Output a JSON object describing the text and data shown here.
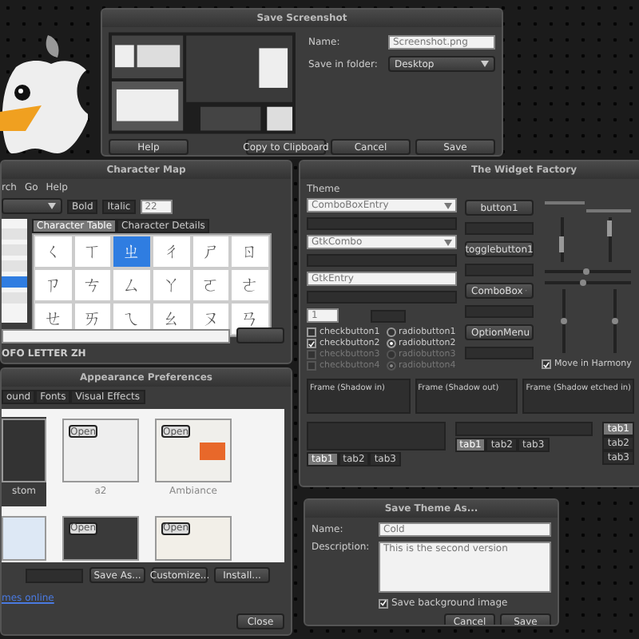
{
  "save_screenshot": {
    "title": "Save Screenshot",
    "name_label": "Name:",
    "name_value": "Screenshot.png",
    "folder_label": "Save in folder:",
    "folder_value": "Desktop",
    "buttons": [
      "Help",
      "Copy to Clipboard",
      "Cancel",
      "Save"
    ]
  },
  "character_map": {
    "title": "Character Map",
    "menu": [
      "rch",
      "Go",
      "Help"
    ],
    "style_buttons": [
      {
        "label": "Bold",
        "selected": false
      },
      {
        "label": "Italic",
        "selected": false
      }
    ],
    "font_size": "22",
    "font_list": [
      {
        "selected": false
      },
      {
        "selected": false
      },
      {
        "selected": false
      },
      {
        "selected": true
      },
      {
        "selected": false
      }
    ],
    "tabs": [
      {
        "label": "Character Table",
        "selected": true
      },
      {
        "label": "Character Details",
        "selected": false
      }
    ],
    "characters": [
      {
        "char": "ㄑ",
        "selected": false
      },
      {
        "char": "ㄒ",
        "selected": false
      },
      {
        "char": "ㄓ",
        "selected": true
      },
      {
        "char": "ㄔ",
        "selected": false
      },
      {
        "char": "ㄕ",
        "selected": false
      },
      {
        "char": "ㄖ",
        "selected": false
      },
      {
        "char": "ㄗ",
        "selected": false
      },
      {
        "char": "ㄘ",
        "selected": false
      },
      {
        "char": "ㄙ",
        "selected": false
      },
      {
        "char": "ㄚ",
        "selected": false
      },
      {
        "char": "ㄛ",
        "selected": false
      },
      {
        "char": "ㄜ",
        "selected": false
      },
      {
        "char": "ㄝ",
        "selected": false
      },
      {
        "char": "ㄞ",
        "selected": false
      },
      {
        "char": "ㄟ",
        "selected": false
      },
      {
        "char": "ㄠ",
        "selected": false
      },
      {
        "char": "ㄡ",
        "selected": false
      },
      {
        "char": "ㄢ",
        "selected": false
      }
    ],
    "status": "OFO LETTER ZH"
  },
  "widget_factory": {
    "title": "The Widget Factory",
    "menu": "Theme",
    "combos": [
      {
        "kind": "combo",
        "value": "ComboBoxEntry"
      },
      {
        "kind": "combo",
        "value": "GtkCombo"
      },
      {
        "kind": "entry",
        "value": "GtkEntry"
      }
    ],
    "spin_value": "1",
    "checks": [
      {
        "label": "checkbutton1",
        "checked": false,
        "disabled": false
      },
      {
        "label": "checkbutton2",
        "checked": true,
        "disabled": false
      },
      {
        "label": "checkbutton3",
        "checked": false,
        "disabled": true
      },
      {
        "label": "checkbutton4",
        "checked": false,
        "disabled": true
      }
    ],
    "radios": [
      {
        "label": "radiobutton1",
        "selected": false,
        "disabled": false
      },
      {
        "label": "radiobutton2",
        "selected": true,
        "disabled": false
      },
      {
        "label": "radiobutton3",
        "selected": false,
        "disabled": true
      },
      {
        "label": "radiobutton4",
        "selected": true,
        "disabled": true
      }
    ],
    "buttons": [
      {
        "kind": "button",
        "label": "button1"
      },
      {
        "kind": "button",
        "label": "togglebutton1"
      },
      {
        "kind": "dropdown",
        "label": "ComboBox"
      },
      {
        "kind": "dropdown",
        "label": "OptionMenu"
      }
    ],
    "harmony": {
      "label": "Move in Harmony",
      "checked": true
    },
    "frames": [
      "Frame (Shadow in)",
      "Frame (Shadow out)",
      "Frame (Shadow etched in)"
    ],
    "tab_sets": [
      [
        {
          "label": "tab1",
          "selected": true
        },
        {
          "label": "tab2",
          "selected": false
        },
        {
          "label": "tab3",
          "selected": false
        }
      ],
      [
        {
          "label": "tab1",
          "selected": true
        },
        {
          "label": "tab2",
          "selected": false
        },
        {
          "label": "tab3",
          "selected": false
        }
      ],
      [
        {
          "label": "tab1",
          "selected": true
        },
        {
          "label": "tab2",
          "selected": false
        },
        {
          "label": "tab3",
          "selected": false
        }
      ]
    ]
  },
  "appearance": {
    "title": "Appearance Preferences",
    "tabs": [
      {
        "label": "ound",
        "selected": false
      },
      {
        "label": "Fonts",
        "selected": false
      },
      {
        "label": "Visual Effects",
        "selected": false
      }
    ],
    "themes": [
      {
        "kind": "dark",
        "name": "stom",
        "selected": true
      },
      {
        "kind": "light",
        "name": "a2",
        "preview_label": "Open",
        "selected": false
      },
      {
        "kind": "ambiance",
        "name": "Ambiance",
        "preview_label": "Open",
        "selected": false
      },
      {
        "kind": "blue",
        "selected": false
      },
      {
        "kind": "darkred",
        "preview_label": "Open",
        "selected": false
      },
      {
        "kind": "beige",
        "preview_label": "Open",
        "selected": false
      }
    ],
    "buttons": [
      "Save As...",
      "Customize...",
      "Install..."
    ],
    "link": "mes online",
    "close": "Close"
  },
  "save_theme": {
    "title": "Save Theme As...",
    "name_label": "Name:",
    "name_value": "Cold",
    "description_label": "Description:",
    "description_value": "This is the second version",
    "background": {
      "label": "Save background image",
      "checked": true
    },
    "buttons": [
      "Cancel",
      "Save"
    ]
  }
}
